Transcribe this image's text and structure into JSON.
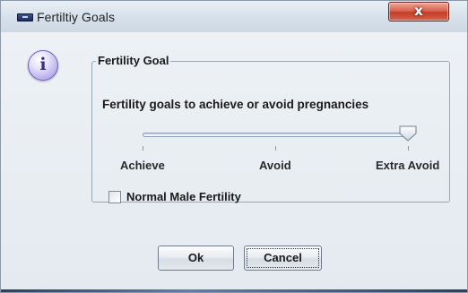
{
  "window": {
    "title": "Fertiltiy Goals",
    "close_label": "x"
  },
  "dialog": {
    "icon": "info-icon",
    "group_title": "Fertility Goal",
    "slider_prompt": "Fertility goals to achieve or avoid pregnancies",
    "slider": {
      "options": [
        "Achieve",
        "Avoid",
        "Extra Avoid"
      ],
      "selected_index": 2,
      "selected_value": "Extra Avoid"
    },
    "checkbox": {
      "label": "Normal Male Fertility",
      "checked": false
    }
  },
  "buttons": {
    "ok_label": "Ok",
    "cancel_label": "Cancel"
  },
  "colors": {
    "close_button": "#c43c26",
    "info_icon": "#b7acec",
    "title_bar": "#d6e0ea"
  }
}
